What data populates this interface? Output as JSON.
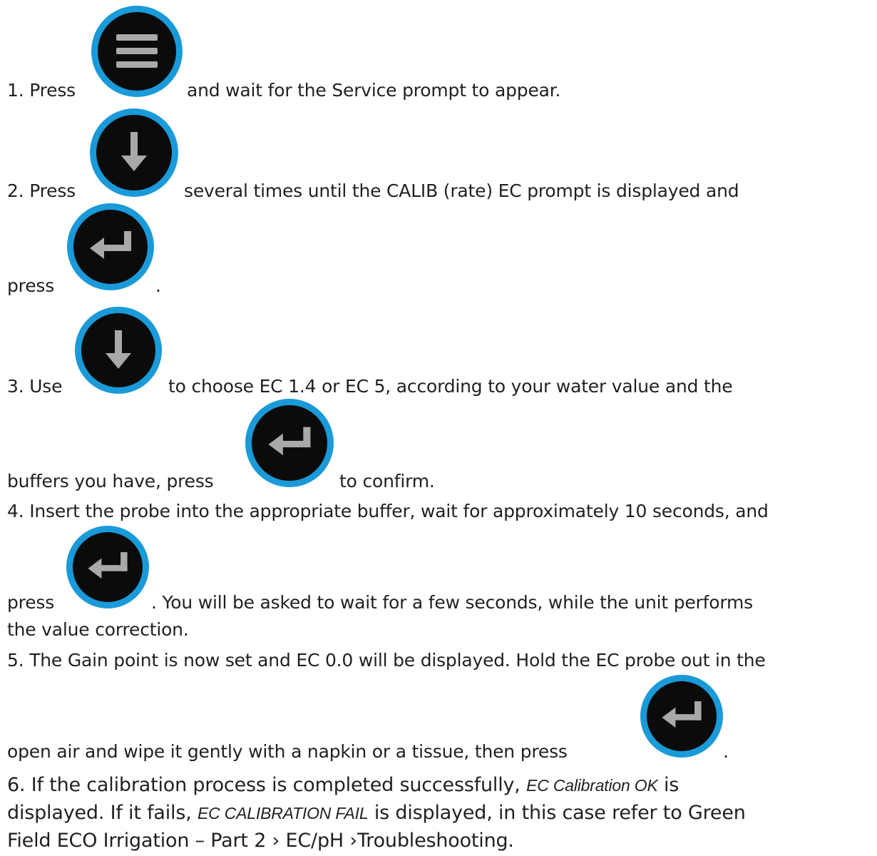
{
  "steps": {
    "s1_a": "1. Press",
    "s1_b": "and wait for the Service prompt to appear.",
    "s2_a": "2. Press",
    "s2_b": "several times until the CALIB (rate) EC prompt is displayed and",
    "s2_c": "press",
    "s2_d": ".",
    "s3_a": "3. Use",
    "s3_b": "to choose EC 1.4 or EC 5, according to your water value and the",
    "s3_c": "buffers you have, press",
    "s3_d": "to confirm.",
    "s4_a": "4. Insert the probe into the appropriate buffer, wait for approximately 10 seconds, and",
    "s4_b": "press",
    "s4_c": ". You will be asked to wait for a few seconds, while the unit performs",
    "s4_d": "the value correction.",
    "s5_a": "5. The Gain point is now set and EC 0.0 will be displayed. Hold the EC probe out in the",
    "s5_b": "open air and wipe it gently with a napkin or a tissue, then press",
    "s5_c": ".",
    "s6_a": "6. If the calibration process is completed successfully,",
    "s6_em1": "EC Calibration OK",
    "s6_b": "is",
    "s6_c": "displayed. If it fails,",
    "s6_em2": "EC CALIBRATION FAIL",
    "s6_d": "is displayed, in this case refer to Green",
    "s6_e": "Field ECO Irrigation – Part 2 › EC/pH ›Troubleshooting."
  },
  "icons": {
    "menu": "menu-icon",
    "down": "down-arrow-icon",
    "enter": "enter-icon"
  },
  "colors": {
    "ring": "#1a9ad8",
    "button": "#0b0b0b",
    "glyph": "#a9a9a9",
    "text": "#1f2024"
  }
}
